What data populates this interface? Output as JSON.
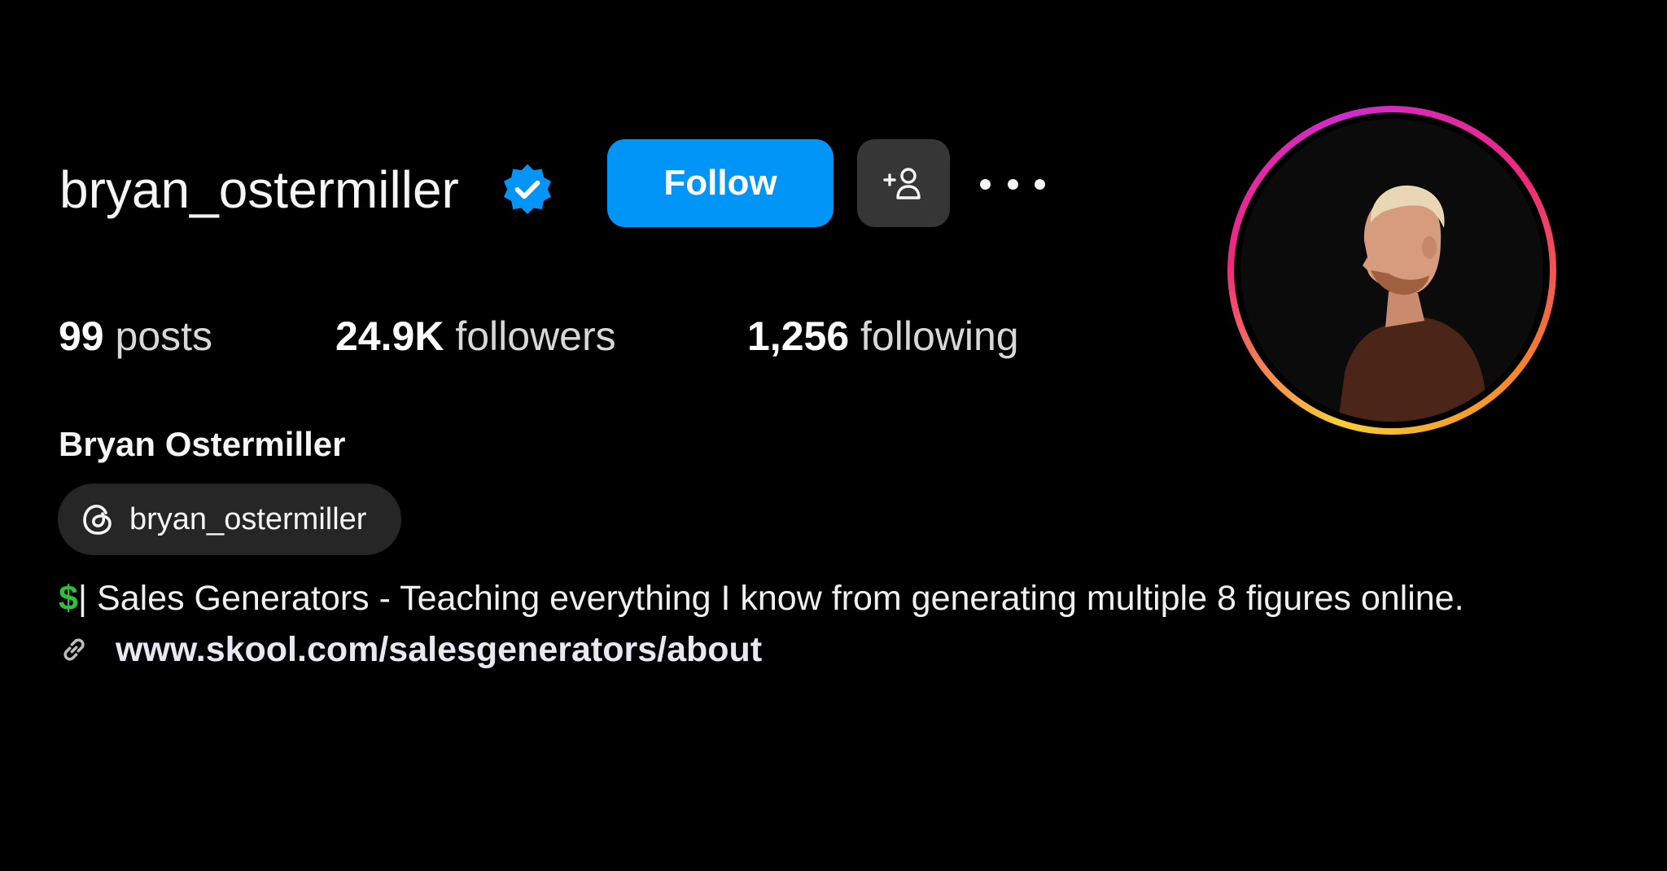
{
  "profile": {
    "username": "bryan_ostermiller",
    "verified_icon": "verified-badge-icon",
    "full_name": "Bryan Ostermiller"
  },
  "actions": {
    "follow_label": "Follow",
    "add_user_icon": "add-user-icon",
    "more_icon": "more-options-icon"
  },
  "stats": {
    "posts_count": "99",
    "posts_label": "posts",
    "followers_count": "24.9K",
    "followers_label": "followers",
    "following_count": "1,256",
    "following_label": "following"
  },
  "threads": {
    "icon": "threads-icon",
    "handle": "bryan_ostermiller"
  },
  "bio": {
    "emoji": "$",
    "text": "| Sales Generators - Teaching everything I know from generating multiple 8 figures online."
  },
  "link": {
    "icon": "link-icon",
    "url": "www.skool.com/salesgenerators/about"
  },
  "colors": {
    "background": "#000000",
    "follow_button": "#0095f6",
    "secondary_button": "#363636",
    "chip": "#262626",
    "verified": "#0095f6",
    "dollar": "#2fbf3a"
  }
}
